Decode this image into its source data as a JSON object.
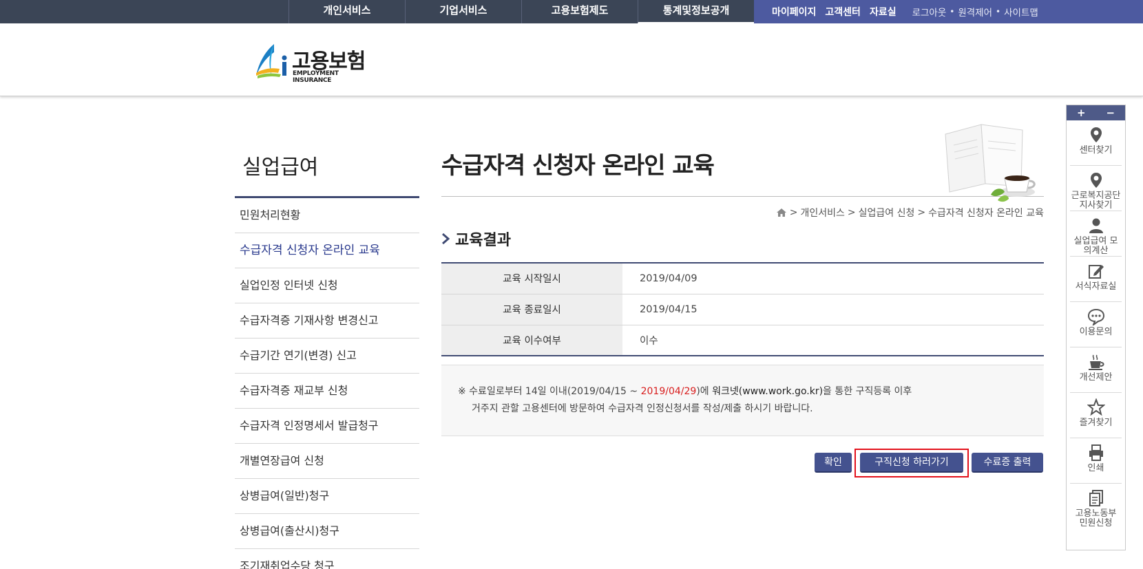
{
  "topnav": {
    "menu": [
      "개인서비스",
      "기업서비스",
      "고용보험제도",
      "통계및정보공개"
    ],
    "util_bold": [
      "마이페이지",
      "고객센터",
      "자료실"
    ],
    "util_links": [
      "로그아웃",
      "원격제어",
      "사이트맵"
    ]
  },
  "logo": {
    "title": "고용보험",
    "subtitle": "EMPLOYMENT INSURANCE"
  },
  "lnb": {
    "title": "실업급여",
    "items": [
      "민원처리현황",
      "수급자격 신청자 온라인 교육",
      "실업인정 인터넷 신청",
      "수급자격증 기재사항 변경신고",
      "수급기간 연기(변경) 신고",
      "수급자격증 재교부 신청",
      "수급자격 인정명세서 발급청구",
      "개별연장급여 신청",
      "상병급여(일반)청구",
      "상병급여(출산시)청구",
      "조기재취업수당 청구"
    ]
  },
  "page": {
    "title": "수급자격 신청자 온라인 교육",
    "breadcrumb": [
      ">",
      "개인서비스",
      ">",
      "실업급여 신청",
      ">",
      "수급자격 신청자 온라인 교육"
    ],
    "section_title": "교육결과"
  },
  "result": {
    "rows": [
      {
        "label": "교육 시작일시",
        "value": "2019/04/09"
      },
      {
        "label": "교육 종료일시",
        "value": "2019/04/15"
      },
      {
        "label": "교육 이수여부",
        "value": "이수"
      }
    ]
  },
  "notice": {
    "prefix": "※ 수료일로부터 14일 이내(2019/04/15 ~ ",
    "date_red": "2019/04/29",
    "mid": ")에 ",
    "site": "워크넷(www.work.go.kr)",
    "suffix": "을 통한 구직등록 이후",
    "line2": "거주지 관할 고용센터에 방문하여 수급자격 인정신청서를 작성/제출 하시기 바랍니다."
  },
  "buttons": {
    "confirm": "확인",
    "job_apply": "구직신청 하러가기",
    "certificate": "수료증 출력"
  },
  "quick": {
    "zoom_in": "+",
    "zoom_out": "−",
    "items": [
      {
        "label": "센터찾기",
        "icon": "map-pin-icon"
      },
      {
        "label": "근로복지공단 지사찾기",
        "icon": "map-pin-icon"
      },
      {
        "label": "실업급여 모의계산",
        "icon": "user-icon"
      },
      {
        "label": "서식자료실",
        "icon": "edit-icon"
      },
      {
        "label": "이용문의",
        "icon": "chat-icon"
      },
      {
        "label": "개선제안",
        "icon": "coffee-icon"
      },
      {
        "label": "즐겨찾기",
        "icon": "star-icon"
      },
      {
        "label": "인쇄",
        "icon": "printer-icon"
      },
      {
        "label": "고용노동부 민원신청",
        "icon": "document-icon"
      }
    ]
  },
  "colors": {
    "nav_dark": "#3b4556",
    "nav_util": "#4d5aa0",
    "accent": "#3f4a72",
    "button": "#44528f",
    "highlight": "#e3101a",
    "red_text": "#d81c1c"
  }
}
